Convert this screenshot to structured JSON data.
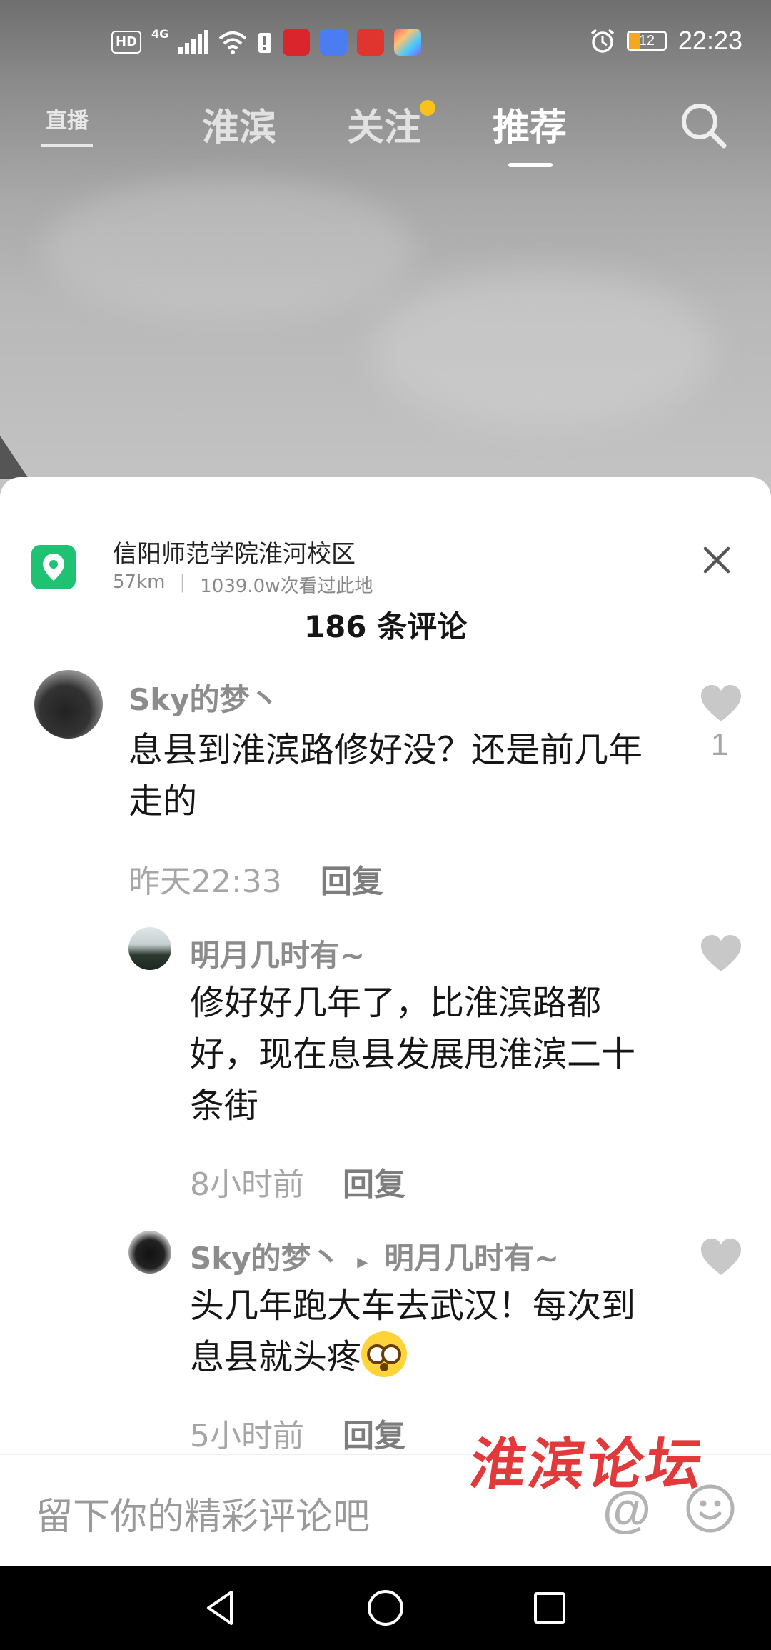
{
  "status_bar": {
    "hd": "HD",
    "network": "4G",
    "battery": "12",
    "time": "22:23"
  },
  "top_nav": {
    "live_label": "直播",
    "tabs": [
      {
        "label": "淮滨",
        "active": false
      },
      {
        "label": "关注",
        "active": false,
        "has_dot": true
      },
      {
        "label": "推荐",
        "active": true
      }
    ]
  },
  "location": {
    "title": "信阳师范学院淮河校区",
    "distance": "57km",
    "separator": "|",
    "views": "1039.0w次看过此地"
  },
  "comments_count": "186 条评论",
  "comments": [
    {
      "user": "Sky的梦丶",
      "text": "息县到淮滨路修好没？还是前几年走的",
      "time": "昨天22:33",
      "reply_label": "回复",
      "likes": "1"
    }
  ],
  "replies": [
    {
      "user": "明月几时有~",
      "text": "修好好几年了，比淮滨路都好，现在息县发展甩淮滨二十条街",
      "time": "8小时前",
      "reply_label": "回复"
    },
    {
      "user": "Sky的梦丶",
      "reply_to_arrow": "▸",
      "reply_to": "明月几时有~",
      "text": "头几年跑大车去武汉！每次到息县就头疼",
      "time": "5小时前",
      "reply_label": "回复"
    }
  ],
  "input": {
    "placeholder": "留下你的精彩评论吧",
    "at_symbol": "@"
  },
  "watermark": "淮滨论坛",
  "colors": {
    "location_green": "#1fc173",
    "tab_dot": "#f7c21a",
    "watermark_red": "#e23a3a",
    "username_gray": "#8c8c8c"
  }
}
